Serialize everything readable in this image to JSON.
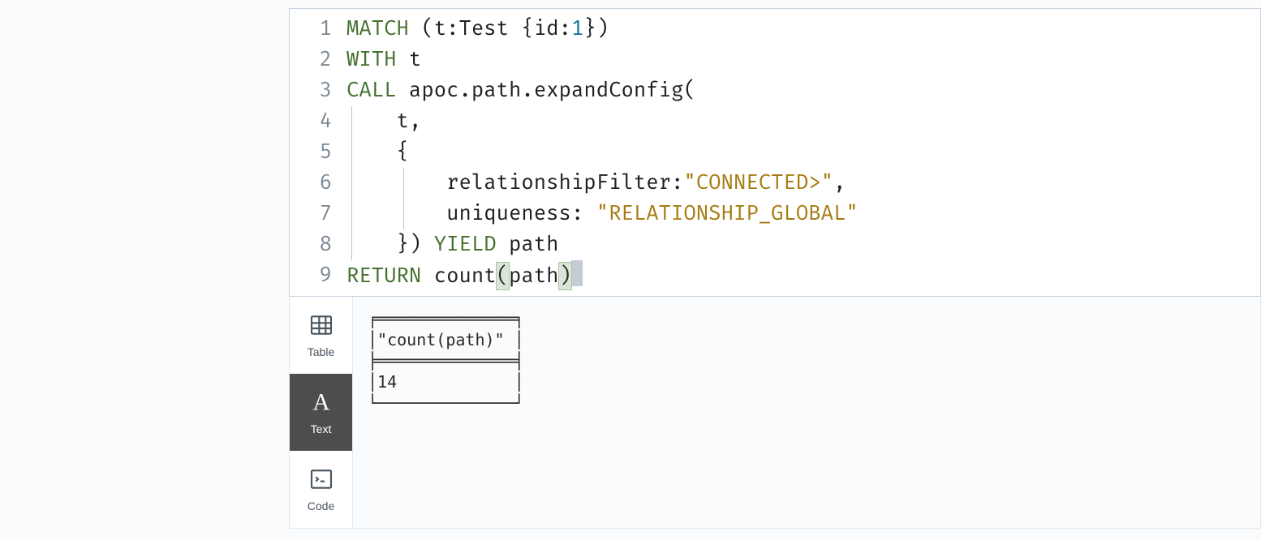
{
  "editor": {
    "lines": [
      {
        "num": "1",
        "tokens": [
          [
            "kw",
            "MATCH"
          ],
          [
            "punct",
            " ("
          ],
          [
            "var",
            "t"
          ],
          [
            "punct",
            ":"
          ],
          [
            "var",
            "Test"
          ],
          [
            "punct",
            " {"
          ],
          [
            "prop",
            "id"
          ],
          [
            "punct",
            ":"
          ],
          [
            "num",
            "1"
          ],
          [
            "punct",
            "})"
          ]
        ]
      },
      {
        "num": "2",
        "tokens": [
          [
            "kw",
            "WITH"
          ],
          [
            "var",
            " t"
          ]
        ]
      },
      {
        "num": "3",
        "tokens": [
          [
            "kw",
            "CALL"
          ],
          [
            "fn",
            " apoc"
          ],
          [
            "punct",
            "."
          ],
          [
            "fn",
            "path"
          ],
          [
            "punct",
            "."
          ],
          [
            "fn",
            "expandConfig"
          ],
          [
            "punct",
            "("
          ]
        ]
      },
      {
        "num": "4",
        "guides": [
          0
        ],
        "tokens": [
          [
            "pad",
            "    "
          ],
          [
            "var",
            "t"
          ],
          [
            "punct",
            ","
          ]
        ]
      },
      {
        "num": "5",
        "guides": [
          0
        ],
        "tokens": [
          [
            "pad",
            "    "
          ],
          [
            "punct",
            "{"
          ]
        ]
      },
      {
        "num": "6",
        "guides": [
          0,
          1
        ],
        "tokens": [
          [
            "pad",
            "        "
          ],
          [
            "prop",
            "relationshipFilter"
          ],
          [
            "punct",
            ":"
          ],
          [
            "str",
            "\"CONNECTED>\""
          ],
          [
            "punct",
            ","
          ]
        ]
      },
      {
        "num": "7",
        "guides": [
          0,
          1
        ],
        "tokens": [
          [
            "pad",
            "        "
          ],
          [
            "prop",
            "uniqueness"
          ],
          [
            "punct",
            ": "
          ],
          [
            "str",
            "\"RELATIONSHIP_GLOBAL\""
          ]
        ]
      },
      {
        "num": "8",
        "guides": [
          0
        ],
        "tokens": [
          [
            "pad",
            "    "
          ],
          [
            "punct",
            "}) "
          ],
          [
            "kw",
            "YIELD"
          ],
          [
            "var",
            " path"
          ]
        ]
      },
      {
        "num": "9",
        "tokens": [
          [
            "kw",
            "RETURN"
          ],
          [
            "fn",
            " count"
          ],
          [
            "hl",
            "("
          ],
          [
            "var",
            "path"
          ],
          [
            "hl",
            ")"
          ],
          [
            "cursor",
            ""
          ]
        ]
      }
    ]
  },
  "viewTabs": {
    "table": "Table",
    "text": "Text",
    "code": "Code"
  },
  "result": {
    "header": "\"count(path)\"",
    "value": "14"
  }
}
